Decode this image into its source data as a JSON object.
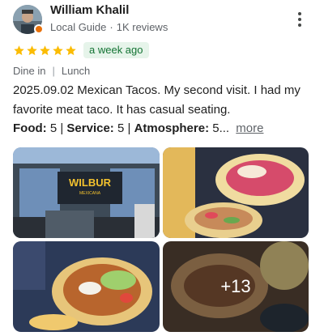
{
  "reviewer": {
    "name": "William Khalil",
    "level": "Local Guide",
    "separator": "·",
    "reviews_count": "1K reviews"
  },
  "rating": {
    "stars": 5,
    "time_ago": "a week ago"
  },
  "tags": {
    "service_type": "Dine in",
    "separator": "|",
    "meal_type": "Lunch"
  },
  "review": {
    "text": "2025.09.02 Mexican Tacos. My second visit. I had my favorite meat taco. It has casual seating.",
    "food_label": "Food:",
    "food_value": "5",
    "service_label": "Service:",
    "service_value": "5",
    "atmosphere_label": "Atmosphere:",
    "atmosphere_value": "5...",
    "attr_sep": "|",
    "more_label": "more"
  },
  "photos": {
    "storefront_sign_line1": "WILBUR",
    "storefront_sign_line2": "MEXICANA",
    "extra_count": "+13"
  },
  "colors": {
    "star": "#fbbc04",
    "badge_bg": "#e6f4ea",
    "badge_text": "#137333",
    "local_guide_badge": "#e8710a"
  }
}
